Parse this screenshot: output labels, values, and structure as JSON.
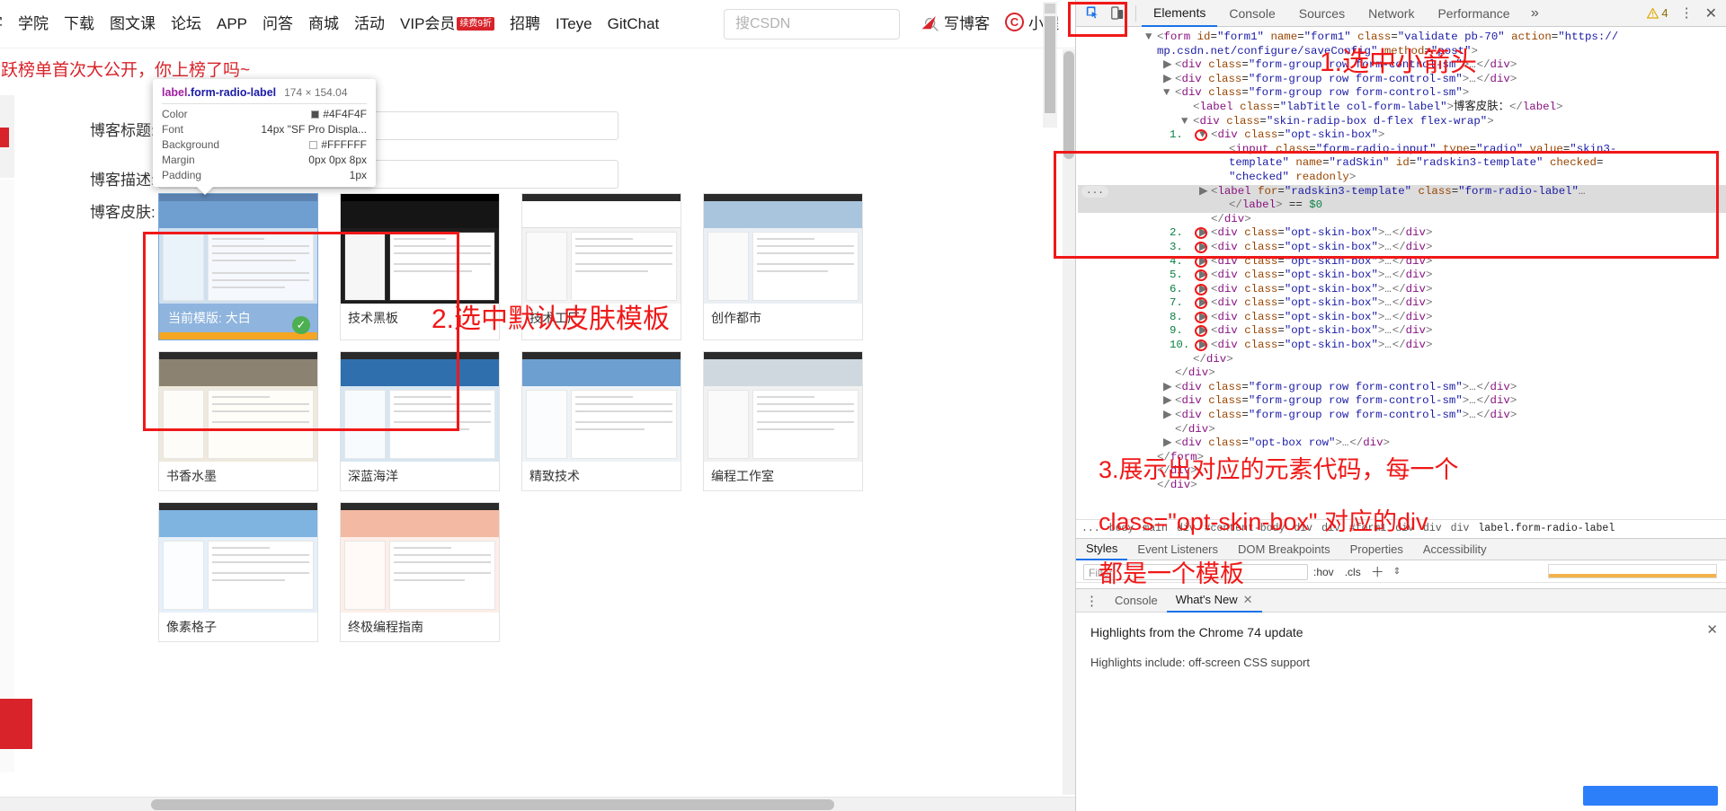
{
  "site_nav": {
    "links": [
      "客",
      "学院",
      "下载",
      "图文课",
      "论坛",
      "APP",
      "问答",
      "商城",
      "活动",
      "VIP会员"
    ],
    "vip_badge": "续费9折",
    "links_after": [
      "招聘",
      "ITeye",
      "GitChat"
    ],
    "search_placeholder": "搜CSDN",
    "search_value": "",
    "write_blog": "写博客",
    "mini_program": "小程"
  },
  "banner": {
    "text": "舌跃榜单首次大公开，你上榜了吗~"
  },
  "form": {
    "title_label": "博客标题:",
    "title_value": "",
    "desc_label": "博客描述:",
    "desc_value": "",
    "skin_label": "博客皮肤:"
  },
  "skins": {
    "current_prefix": "当前模版: 大白",
    "items": [
      {
        "name": "当前模版: 大白",
        "selected": true,
        "style": "light-blue"
      },
      {
        "name": "技术黑板",
        "selected": false,
        "style": "dark"
      },
      {
        "name": "技术工厂",
        "selected": false,
        "style": "white"
      },
      {
        "name": "创作都市",
        "selected": false,
        "style": "city"
      },
      {
        "name": "书香水墨",
        "selected": false,
        "style": "ink"
      },
      {
        "name": "深蓝海洋",
        "selected": false,
        "style": "ocean"
      },
      {
        "name": "精致技术",
        "selected": false,
        "style": "fine"
      },
      {
        "name": "编程工作室",
        "selected": false,
        "style": "studio"
      },
      {
        "name": "像素格子",
        "selected": false,
        "style": "pixel"
      },
      {
        "name": "终极编程指南",
        "selected": false,
        "style": "guide"
      }
    ]
  },
  "inspect_tooltip": {
    "tag": "label",
    "class": ".form-radio-label",
    "dimensions": "174 × 154.04",
    "rows": [
      {
        "k": "Color",
        "v": "#4F4F4F",
        "swatch": "#4F4F4F"
      },
      {
        "k": "Font",
        "v": "14px \"SF Pro Displa...",
        "swatch": null
      },
      {
        "k": "Background",
        "v": "#FFFFFF",
        "swatch": "#FFFFFF"
      },
      {
        "k": "Margin",
        "v": "0px 0px 8px",
        "swatch": null
      },
      {
        "k": "Padding",
        "v": "1px",
        "swatch": null
      }
    ]
  },
  "annotations": {
    "a1": "1.选中小箭头",
    "a2": "2.选中默认皮肤模板",
    "a3_line1": "3.展示出对应的元素代码，每一个",
    "a3_line2": "class=\"opt-skin-box\" 对应的div",
    "a3_line3": "都是一个模板"
  },
  "devtools": {
    "tabs": [
      "Elements",
      "Console",
      "Sources",
      "Network",
      "Performance"
    ],
    "active_tab": "Elements",
    "more_tabs_icon": "chevron-double-right-icon",
    "warning_count": "4",
    "inspect_icon": "inspect-cursor-icon",
    "device_icon": "device-toolbar-icon",
    "kebab_icon": "more-vertical-icon",
    "close_icon": "close-icon",
    "dom_lines": [
      {
        "indent": 0,
        "num": "",
        "arrow": "▼",
        "html": "<span class='tk-arr'>&lt;</span><span class='tk-tag'>form</span> <span class='tk-attr'>id</span>=<span class='tk-val'>\"form1\"</span> <span class='tk-attr'>name</span>=<span class='tk-val'>\"form1\"</span> <span class='tk-attr'>class</span>=<span class='tk-val'>\"validate pb-70\"</span> <span class='tk-attr'>action</span>=<span class='tk-val'>\"https://</span>"
      },
      {
        "indent": 0,
        "num": "",
        "arrow": "",
        "html": "<span class='tk-val'>mp.csdn.net/configure/saveConfig\"</span> <span class='tk-attr'>method</span>=<span class='tk-val'>\"post\"</span><span class='tk-arr'>&gt;</span>"
      },
      {
        "indent": 1,
        "num": "",
        "arrow": "▶",
        "html": "<span class='tk-arr'>&lt;</span><span class='tk-tag'>div</span> <span class='tk-attr'>class</span>=<span class='tk-val'>\"form-group row form-control-sm\"</span><span class='tk-arr'>&gt;</span><span class='dots'>…</span><span class='tk-arr'>&lt;/</span><span class='tk-tag'>div</span><span class='tk-arr'>&gt;</span>"
      },
      {
        "indent": 1,
        "num": "",
        "arrow": "▶",
        "html": "<span class='tk-arr'>&lt;</span><span class='tk-tag'>div</span> <span class='tk-attr'>class</span>=<span class='tk-val'>\"form-group row form-control-sm\"</span><span class='tk-arr'>&gt;</span><span class='dots'>…</span><span class='tk-arr'>&lt;/</span><span class='tk-tag'>div</span><span class='tk-arr'>&gt;</span>"
      },
      {
        "indent": 1,
        "num": "",
        "arrow": "▼",
        "html": "<span class='tk-arr'>&lt;</span><span class='tk-tag'>div</span> <span class='tk-attr'>class</span>=<span class='tk-val'>\"form-group row form-control-sm\"</span><span class='tk-arr'>&gt;</span>"
      },
      {
        "indent": 2,
        "num": "",
        "arrow": "",
        "html": "<span class='tk-arr'>&lt;</span><span class='tk-tag'>label</span> <span class='tk-attr'>class</span>=<span class='tk-val'>\"labTitle col-form-label\"</span><span class='tk-arr'>&gt;</span><span class='tk-txt'>博客皮肤：</span><span class='tk-arr'>&lt;/</span><span class='tk-tag'>label</span><span class='tk-arr'>&gt;</span>"
      },
      {
        "indent": 2,
        "num": "",
        "arrow": "▼",
        "html": "<span class='tk-arr'>&lt;</span><span class='tk-tag'>div</span> <span class='tk-attr'>class</span>=<span class='tk-val'>\"skin-radip-box d-flex flex-wrap\"</span><span class='tk-arr'>&gt;</span>"
      },
      {
        "indent": 3,
        "num": "1.",
        "arrow": "▼",
        "ring": true,
        "html": "<span class='tk-arr'>&lt;</span><span class='tk-tag'>div</span> <span class='tk-attr'>class</span>=<span class='tk-val'>\"opt-skin-box\"</span><span class='tk-arr'>&gt;</span>"
      },
      {
        "indent": 4,
        "num": "",
        "arrow": "",
        "html": "<span class='tk-arr'>&lt;</span><span class='tk-tag'>input</span> <span class='tk-attr'>class</span>=<span class='tk-val'>\"form-radio-input\"</span> <span class='tk-attr'>type</span>=<span class='tk-val'>\"radio\"</span> <span class='tk-attr'>value</span>=<span class='tk-val'>\"skin3-</span>"
      },
      {
        "indent": 4,
        "num": "",
        "arrow": "",
        "html": "<span class='tk-val'>template\"</span> <span class='tk-attr'>name</span>=<span class='tk-val'>\"radSkin\"</span> <span class='tk-attr'>id</span>=<span class='tk-val'>\"radskin3-template\"</span> <span class='tk-attr'>checked</span>="
      },
      {
        "indent": 4,
        "num": "",
        "arrow": "",
        "html": "<span class='tk-val'>\"checked\"</span> <span class='tk-attr'>readonly</span><span class='tk-arr'>&gt;</span>"
      },
      {
        "indent": 3,
        "num": "",
        "arrow": "▶",
        "selected": true,
        "html": "<span class='tk-arr'>&lt;</span><span class='tk-tag'>label</span> <span class='tk-attr'>for</span>=<span class='tk-val'>\"radskin3-template\"</span> <span class='tk-attr'>class</span>=<span class='tk-val'>\"form-radio-label\"</span><span class='dots'>…</span>"
      },
      {
        "indent": 4,
        "num": "",
        "arrow": "",
        "selected": true,
        "html": "<span class='tk-arr'>&lt;/</span><span class='tk-tag'>label</span><span class='tk-arr'>&gt;</span> == <span class='tk-num'>$0</span>"
      },
      {
        "indent": 3,
        "num": "",
        "arrow": "",
        "html": "<span class='tk-arr'>&lt;/</span><span class='tk-tag'>div</span><span class='tk-arr'>&gt;</span>"
      },
      {
        "indent": 3,
        "num": "2.",
        "arrow": "▶",
        "ring": true,
        "html": "<span class='tk-arr'>&lt;</span><span class='tk-tag'>div</span> <span class='tk-attr'>class</span>=<span class='tk-val'>\"opt-skin-box\"</span><span class='tk-arr'>&gt;</span><span class='dots'>…</span><span class='tk-arr'>&lt;/</span><span class='tk-tag'>div</span><span class='tk-arr'>&gt;</span>"
      },
      {
        "indent": 3,
        "num": "3.",
        "arrow": "▶",
        "ring": true,
        "html": "<span class='tk-arr'>&lt;</span><span class='tk-tag'>div</span> <span class='tk-attr'>class</span>=<span class='tk-val'>\"opt-skin-box\"</span><span class='tk-arr'>&gt;</span><span class='dots'>…</span><span class='tk-arr'>&lt;/</span><span class='tk-tag'>div</span><span class='tk-arr'>&gt;</span>"
      },
      {
        "indent": 3,
        "num": "4.",
        "arrow": "▶",
        "ring": true,
        "html": "<span class='tk-arr'>&lt;</span><span class='tk-tag'>div</span> <span class='tk-attr'>class</span>=<span class='tk-val'>\"opt-skin-box\"</span><span class='tk-arr'>&gt;</span><span class='dots'>…</span><span class='tk-arr'>&lt;/</span><span class='tk-tag'>div</span><span class='tk-arr'>&gt;</span>"
      },
      {
        "indent": 3,
        "num": "5.",
        "arrow": "▶",
        "ring": true,
        "html": "<span class='tk-arr'>&lt;</span><span class='tk-tag'>div</span> <span class='tk-attr'>class</span>=<span class='tk-val'>\"opt-skin-box\"</span><span class='tk-arr'>&gt;</span><span class='dots'>…</span><span class='tk-arr'>&lt;/</span><span class='tk-tag'>div</span><span class='tk-arr'>&gt;</span>"
      },
      {
        "indent": 3,
        "num": "6.",
        "arrow": "▶",
        "ring": true,
        "html": "<span class='tk-arr'>&lt;</span><span class='tk-tag'>div</span> <span class='tk-attr'>class</span>=<span class='tk-val'>\"opt-skin-box\"</span><span class='tk-arr'>&gt;</span><span class='dots'>…</span><span class='tk-arr'>&lt;/</span><span class='tk-tag'>div</span><span class='tk-arr'>&gt;</span>"
      },
      {
        "indent": 3,
        "num": "7.",
        "arrow": "▶",
        "ring": true,
        "html": "<span class='tk-arr'>&lt;</span><span class='tk-tag'>div</span> <span class='tk-attr'>class</span>=<span class='tk-val'>\"opt-skin-box\"</span><span class='tk-arr'>&gt;</span><span class='dots'>…</span><span class='tk-arr'>&lt;/</span><span class='tk-tag'>div</span><span class='tk-arr'>&gt;</span>"
      },
      {
        "indent": 3,
        "num": "8.",
        "arrow": "▶",
        "ring": true,
        "html": "<span class='tk-arr'>&lt;</span><span class='tk-tag'>div</span> <span class='tk-attr'>class</span>=<span class='tk-val'>\"opt-skin-box\"</span><span class='tk-arr'>&gt;</span><span class='dots'>…</span><span class='tk-arr'>&lt;/</span><span class='tk-tag'>div</span><span class='tk-arr'>&gt;</span>"
      },
      {
        "indent": 3,
        "num": "9.",
        "arrow": "▶",
        "ring": true,
        "html": "<span class='tk-arr'>&lt;</span><span class='tk-tag'>div</span> <span class='tk-attr'>class</span>=<span class='tk-val'>\"opt-skin-box\"</span><span class='tk-arr'>&gt;</span><span class='dots'>…</span><span class='tk-arr'>&lt;/</span><span class='tk-tag'>div</span><span class='tk-arr'>&gt;</span>"
      },
      {
        "indent": 3,
        "num": "10.",
        "arrow": "▶",
        "ring": true,
        "html": "<span class='tk-arr'>&lt;</span><span class='tk-tag'>div</span> <span class='tk-attr'>class</span>=<span class='tk-val'>\"opt-skin-box\"</span><span class='tk-arr'>&gt;</span><span class='dots'>…</span><span class='tk-arr'>&lt;/</span><span class='tk-tag'>div</span><span class='tk-arr'>&gt;</span>"
      },
      {
        "indent": 2,
        "num": "",
        "arrow": "",
        "html": "<span class='tk-arr'>&lt;/</span><span class='tk-tag'>div</span><span class='tk-arr'>&gt;</span>"
      },
      {
        "indent": 1,
        "num": "",
        "arrow": "",
        "html": "<span class='tk-arr'>&lt;/</span><span class='tk-tag'>div</span><span class='tk-arr'>&gt;</span>"
      },
      {
        "indent": 1,
        "num": "",
        "arrow": "▶",
        "html": "<span class='tk-arr'>&lt;</span><span class='tk-tag'>div</span> <span class='tk-attr'>class</span>=<span class='tk-val'>\"form-group row form-control-sm\"</span><span class='tk-arr'>&gt;</span><span class='dots'>…</span><span class='tk-arr'>&lt;/</span><span class='tk-tag'>div</span><span class='tk-arr'>&gt;</span>"
      },
      {
        "indent": 1,
        "num": "",
        "arrow": "▶",
        "html": "<span class='tk-arr'>&lt;</span><span class='tk-tag'>div</span> <span class='tk-attr'>class</span>=<span class='tk-val'>\"form-group row form-control-sm\"</span><span class='tk-arr'>&gt;</span><span class='dots'>…</span><span class='tk-arr'>&lt;/</span><span class='tk-tag'>div</span><span class='tk-arr'>&gt;</span>"
      },
      {
        "indent": 1,
        "num": "",
        "arrow": "▶",
        "html": "<span class='tk-arr'>&lt;</span><span class='tk-tag'>div</span> <span class='tk-attr'>class</span>=<span class='tk-val'>\"form-group row form-control-sm\"</span><span class='tk-arr'>&gt;</span><span class='dots'>…</span><span class='tk-arr'>&lt;/</span><span class='tk-tag'>div</span><span class='tk-arr'>&gt;</span>"
      },
      {
        "indent": 1,
        "num": "",
        "arrow": "",
        "html": "<span class='tk-arr'>&lt;/</span><span class='tk-tag'>div</span><span class='tk-arr'>&gt;</span>"
      },
      {
        "indent": 1,
        "num": "",
        "arrow": "▶",
        "html": "<span class='tk-arr'>&lt;</span><span class='tk-tag'>div</span> <span class='tk-attr'>class</span>=<span class='tk-val'>\"opt-box row\"</span><span class='tk-arr'>&gt;</span><span class='dots'>…</span><span class='tk-arr'>&lt;/</span><span class='tk-tag'>div</span><span class='tk-arr'>&gt;</span>"
      },
      {
        "indent": 0,
        "num": "",
        "arrow": "",
        "html": "<span class='tk-arr'>&lt;/</span><span class='tk-tag'>form</span><span class='tk-arr'>&gt;</span>"
      },
      {
        "indent": 0,
        "num": "",
        "arrow": "",
        "html": "<span class='tk-arr'>&lt;/</span><span class='tk-tag'>div</span><span class='tk-arr'>&gt;</span>"
      },
      {
        "indent": 0,
        "num": "",
        "arrow": "",
        "html": "<span class='tk-arr'>&lt;/</span><span class='tk-tag'>div</span><span class='tk-arr'>&gt;</span>"
      }
    ],
    "breadcrumb": [
      "...",
      "body",
      "main",
      "div",
      "#content-body",
      "div",
      "div",
      "#form1",
      "div",
      "div",
      "div",
      "label.form-radio-label"
    ],
    "styles_tabs": [
      "Styles",
      "Event Listeners",
      "DOM Breakpoints",
      "Properties",
      "Accessibility"
    ],
    "styles_active": "Styles",
    "filter_placeholder": "Filter",
    "hov_label": ":hov",
    "cls_label": ".cls",
    "plus_icon": "plus-icon",
    "drawer": {
      "tabs": [
        "Console",
        "What's New"
      ],
      "active": "What's New",
      "heading": "Highlights from the Chrome 74 update",
      "body": "Highlights include: off-screen CSS support"
    }
  }
}
